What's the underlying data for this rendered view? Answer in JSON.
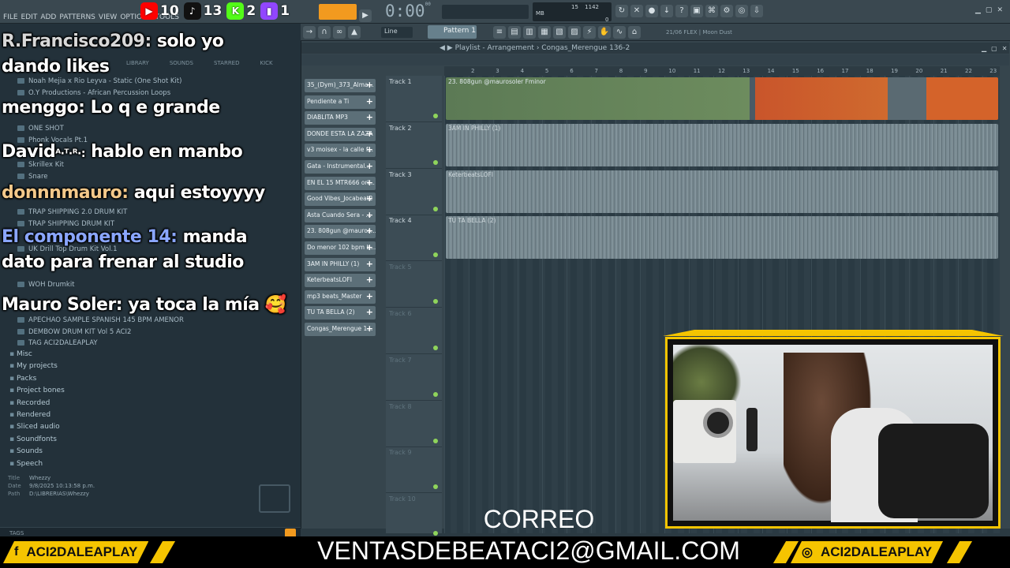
{
  "menu": [
    "FILE",
    "EDIT",
    "ADD",
    "PATTERNS",
    "VIEW",
    "OPTIONS",
    "TOOLS"
  ],
  "socials": [
    {
      "name": "youtube-icon",
      "count": "10",
      "color": "#ff0000",
      "glyph": "▶"
    },
    {
      "name": "tiktok-icon",
      "count": "13",
      "color": "#111111",
      "glyph": "♪"
    },
    {
      "name": "kick-icon",
      "count": "2",
      "color": "#53fc18",
      "glyph": "K"
    },
    {
      "name": "twitch-icon",
      "count": "1",
      "color": "#9146ff",
      "glyph": "▮"
    }
  ],
  "transport": {
    "time": "0:00",
    "time_sub": "00",
    "mem": "1142 MB",
    "cpu": "15",
    "voices": "0"
  },
  "toolbar2": {
    "snap": "Line",
    "pattern": "Pattern 1",
    "hint": "21/06  FLEX | Moon Dust"
  },
  "browser": {
    "tabs": [
      "LIBRARY",
      "SOUNDS",
      "STARRED",
      "KICK"
    ],
    "items": [
      "Noah Mejia x Rio Leyva - Static (One Shot Kit)",
      "O.Y Productions - African Percussion Loops",
      "ONE SHOT",
      "Phonk Vocals Pt.1",
      "Skrillex Kit",
      "Snare",
      "TRAP SHIPPING 2.0 DRUM KIT",
      "TRAP SHIPPING DRUM KIT",
      "UK Drill Top Drum Kit Vol.1",
      "WOH Drumkit",
      "APECHAO SAMPLE SPANISH 145 BPM AMENOR",
      "DEMBOW DRUM KIT Vol 5 ACI2",
      "TAG ACI2DALEAPLAY"
    ],
    "folders": [
      "Misc",
      "My projects",
      "Packs",
      "Project bones",
      "Recorded",
      "Rendered",
      "Sliced audio",
      "Soundfonts",
      "Sounds",
      "Speech"
    ],
    "info": {
      "title_label": "Title",
      "title": "Whezzy",
      "date_label": "Date",
      "date": "9/8/2025 10:13:58 p.m.",
      "path_label": "Path",
      "path": "D:\\LIBRERIAS\\Whezzy"
    },
    "tags_label": "TAGS"
  },
  "chat": [
    {
      "name": "R.Francisco209:",
      "msg": "solo yo",
      "name_color": "#d8d8d8"
    },
    {
      "name": "",
      "msg": "dando likes",
      "name_color": "#ffffff"
    },
    {
      "name": "menggo:",
      "msg": "Lo q e grande",
      "name_color": "#ffffff"
    },
    {
      "name": "David",
      "msg": "hablo en manbo",
      "name_color": "#ffffff",
      "badge": "ᴬ·ᵀ·ᴿ·:"
    },
    {
      "name": "donnnmauro:",
      "msg": "aqui estoyyyy",
      "name_color": "#f3c88a"
    },
    {
      "name": "El componente 14:",
      "msg": "manda",
      "name_color": "#8aa6ff"
    },
    {
      "name": "",
      "msg": "dato para frenar al studio",
      "name_color": "#ffffff"
    },
    {
      "name": "Mauro Soler:",
      "msg": "ya toca la mía 🥰",
      "name_color": "#ffffff"
    }
  ],
  "playlist": {
    "title": "Playlist - Arrangement",
    "crumb": "Congas_Merengue 136-2",
    "ruler": [
      "2",
      "3",
      "4",
      "5",
      "6",
      "7",
      "8",
      "9",
      "10",
      "11",
      "12",
      "13",
      "14",
      "15",
      "16",
      "17",
      "18",
      "19",
      "20",
      "21",
      "22",
      "23"
    ],
    "patterns": [
      "35_(Dym)_373_Alma...",
      "Pendiente a Ti",
      "DIABLITA MP3",
      "DONDE ESTA LA ZAZA",
      "v3 moisex - la calle f...",
      "Gata - Instrumental...",
      "EN EL 15 MTR666 ori...",
      "Good Vibes_Jocabeat2",
      "Asta Cuando Sera - ...",
      "23. 808gun @mauros...",
      "Do menor 102 bpm b...",
      "3AM IN PHILLY (1)",
      "KeterbeatsLOFI",
      "mp3 beats_Master",
      "TU TA BELLA (2)",
      "Congas_Merengue 1..."
    ],
    "tracks": [
      {
        "name": "Track 1",
        "clip": "23. 808gun @maurosoler Fminor",
        "color": "green"
      },
      {
        "name": "Track 2",
        "clip": "3AM IN PHILLY (1)",
        "color": "gray"
      },
      {
        "name": "Track 3",
        "clip": "KeterbeatsLOFI",
        "color": "gray"
      },
      {
        "name": "Track 4",
        "clip": "TU TA BELLA (2)",
        "color": "gray"
      },
      {
        "name": "Track 5",
        "clip": "",
        "color": "none"
      },
      {
        "name": "Track 6",
        "clip": "",
        "color": "none"
      },
      {
        "name": "Track 7",
        "clip": "",
        "color": "none"
      },
      {
        "name": "Track 8",
        "clip": "",
        "color": "none"
      },
      {
        "name": "Track 9",
        "clip": "",
        "color": "none"
      },
      {
        "name": "Track 10",
        "clip": "",
        "color": "none"
      }
    ]
  },
  "overlay": {
    "correo": "CORREO",
    "email": "VENTASDEBEATACI2@GMAIL.COM",
    "left_handle": "ACI2DALEAPLAY",
    "right_handle": "ACI2DALEAPLAY",
    "accent": "#f5c400"
  }
}
